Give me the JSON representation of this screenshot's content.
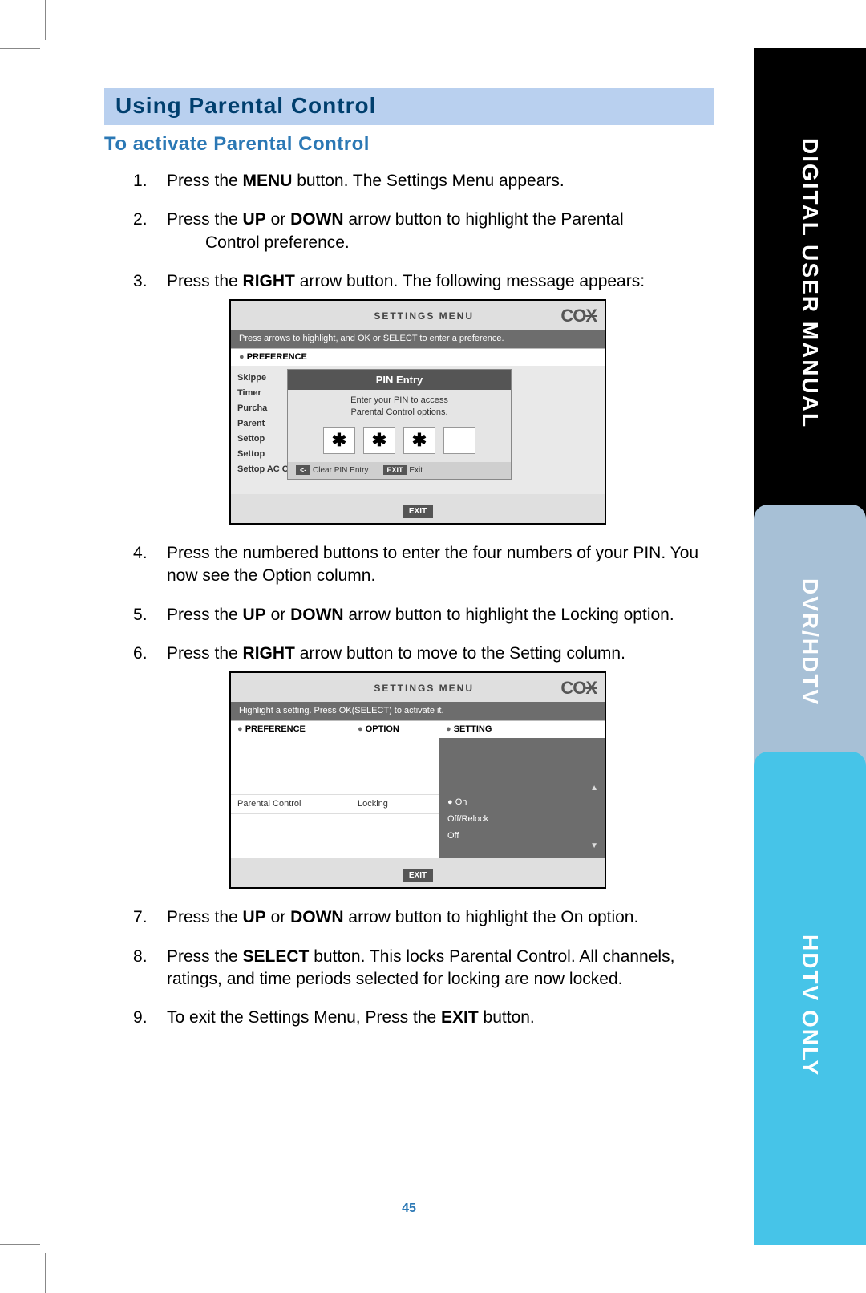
{
  "sidebar": {
    "tab1": "DIGITAL USER MANUAL",
    "tab2": "DVR/HDTV",
    "tab3": "HDTV ONLY"
  },
  "banner": "Using Parental Control",
  "subheading": "To activate Parental Control",
  "steps": {
    "s1a": "Press the ",
    "s1b": "MENU",
    "s1c": " button. The Settings Menu appears.",
    "s2a": "Press the ",
    "s2b": "UP",
    "s2c": " or ",
    "s2d": "DOWN",
    "s2e": " arrow button to highlight the Parental",
    "s2f": "Control preference.",
    "s3a": "Press the ",
    "s3b": "RIGHT",
    "s3c": " arrow button. The following message appears:",
    "s4": "Press the numbered buttons to enter the four numbers of your PIN. You now see the Option column.",
    "s5a": "Press the ",
    "s5b": "UP",
    "s5c": " or ",
    "s5d": "DOWN",
    "s5e": " arrow button to highlight the Locking option.",
    "s6a": "Press the ",
    "s6b": "RIGHT",
    "s6c": " arrow button to move to the Setting column.",
    "s7a": "Press the ",
    "s7b": "UP",
    "s7c": " or ",
    "s7d": "DOWN",
    "s7e": " arrow button to highlight the On option.",
    "s8a": "Press the ",
    "s8b": "SELECT",
    "s8c": " button. This locks Parental Control. All channels, ratings, and time periods selected for locking are now locked.",
    "s9a": "To exit the Settings Menu, Press the ",
    "s9b": "EXIT",
    "s9c": " button."
  },
  "page_number": "45",
  "shot1": {
    "title": "SETTINGS MENU",
    "brand": "COX",
    "instr": "Press arrows to highlight, and OK or SELECT to enter a preference.",
    "pref": "PREFERENCE",
    "side": [
      "Skippe",
      "Timer",
      "Purcha",
      "Parent",
      "Settop",
      "Settop",
      "Settop AC Outlet"
    ],
    "pin_title": "PIN Entry",
    "pin_msg1": "Enter your PIN to access",
    "pin_msg2": "Parental Control options.",
    "stars": [
      "✱",
      "✱",
      "✱",
      ""
    ],
    "clear_key": "<-",
    "clear_lbl": "Clear PIN Entry",
    "exit_key": "EXIT",
    "exit_lbl": "Exit",
    "exit_btn": "EXIT"
  },
  "shot2": {
    "title": "SETTINGS MENU",
    "brand": "COX",
    "instr": "Highlight a setting. Press OK(SELECT) to activate it.",
    "h_pref": "PREFERENCE",
    "h_opt": "OPTION",
    "h_set": "SETTING",
    "row_pref": "Parental Control",
    "row_opt": "Locking",
    "opt_on": "On",
    "opt_offrelock": "Off/Relock",
    "opt_off": "Off",
    "exit_btn": "EXIT"
  }
}
